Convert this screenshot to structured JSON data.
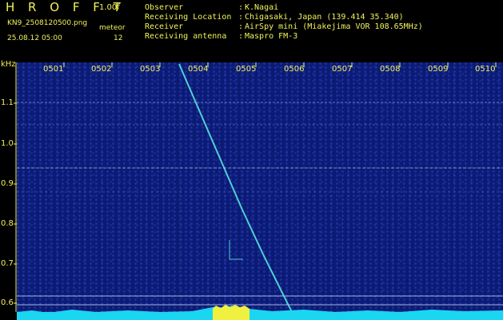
{
  "header": {
    "brand": "H R O F F T",
    "version": "1.00f",
    "filename": "KN9_2508120500.png",
    "timestamp": "25.08.12 05:00",
    "meteor_label": "meteor",
    "meteor_count": "12"
  },
  "info": [
    {
      "label": "Observer",
      "value": "K.Nagai"
    },
    {
      "label": "Receiving Location",
      "value": "Chigasaki, Japan (139.414 35.340)"
    },
    {
      "label": "Receiver",
      "value": "AirSpy mini (Miakejima VOR 108.65MHz)"
    },
    {
      "label": "Receiving antenna",
      "value": "Maspro FM-3"
    }
  ],
  "axis": {
    "unit": "kHz",
    "time_ticks": [
      "0501",
      "0502",
      "0503",
      "0504",
      "0505",
      "0506",
      "0507",
      "0508",
      "0509",
      "0510"
    ],
    "freq_ticks": [
      "1.1",
      "1.0",
      "0.9",
      "0.8",
      "0.7",
      "0.6"
    ]
  },
  "colors": {
    "background": "#0b1a74",
    "label": "#f2f25a",
    "trace": "#5af0e0",
    "baseline": "#1ad6f0"
  }
}
